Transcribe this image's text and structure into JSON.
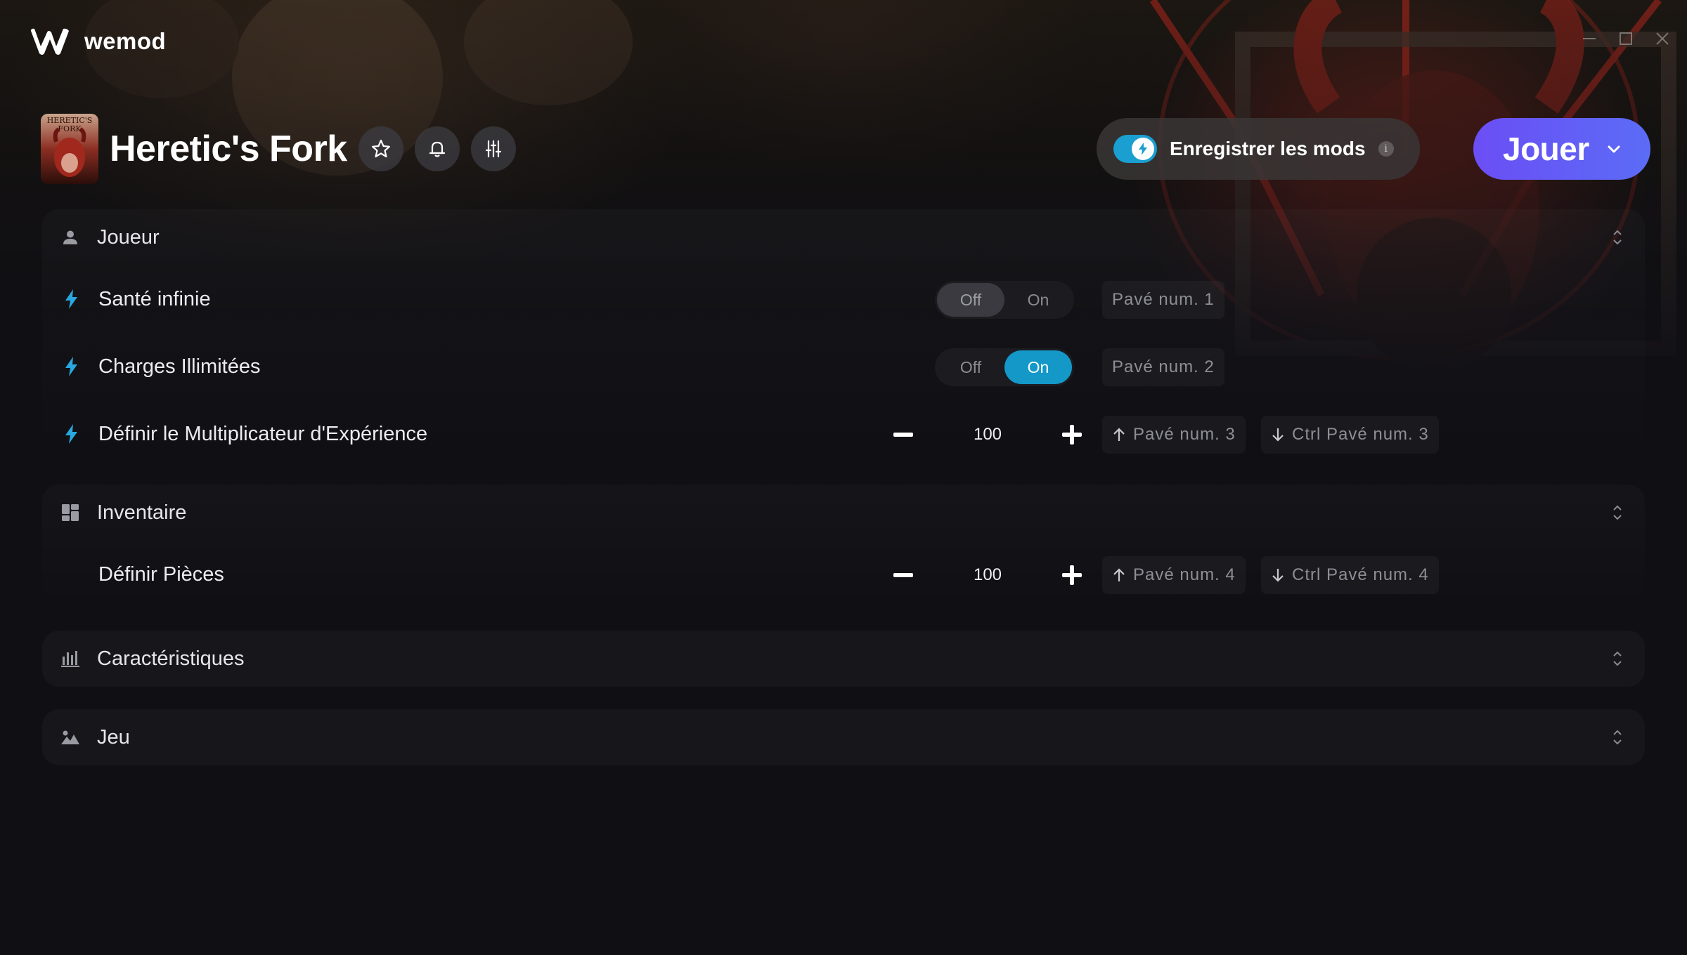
{
  "app": {
    "brand": "wemod"
  },
  "game": {
    "title": "Heretic's Fork",
    "thumb_title": "HERETIC'S FORK"
  },
  "header": {
    "favorite_icon": "star-icon",
    "notify_icon": "bell-icon",
    "settings_icon": "sliders-icon",
    "save_mods_label": "Enregistrer les mods",
    "save_mods_on": true,
    "info_glyph": "i",
    "play_label": "Jouer"
  },
  "colors": {
    "accent_toggle": "#1398c8",
    "play_gradient_start": "#6b4ef5",
    "play_gradient_end": "#5b6cf6",
    "mod_icon": "#29a8e0"
  },
  "sections": [
    {
      "title": "Joueur",
      "icon": "user-icon",
      "expanded": true,
      "mods": [
        {
          "label": "Santé infinie",
          "type": "toggle",
          "off_label": "Off",
          "on_label": "On",
          "state": "off",
          "hotkeys": [
            "Pavé num. 1"
          ]
        },
        {
          "label": "Charges Illimitées",
          "type": "toggle",
          "off_label": "Off",
          "on_label": "On",
          "state": "on",
          "hotkeys": [
            "Pavé num. 2"
          ]
        },
        {
          "label": "Définir le Multiplicateur d'Expérience",
          "type": "stepper",
          "value": "100",
          "hotkeys": [
            "Pavé num. 3",
            "Ctrl Pavé num. 3"
          ]
        }
      ]
    },
    {
      "title": "Inventaire",
      "icon": "grid-icon",
      "expanded": true,
      "mods": [
        {
          "label": "Définir Pièces",
          "type": "stepper",
          "value": "100",
          "hotkeys": [
            "Pavé num. 4",
            "Ctrl Pavé num. 4"
          ]
        }
      ]
    },
    {
      "title": "Caractéristiques",
      "icon": "bar-chart-icon",
      "expanded": false
    },
    {
      "title": "Jeu",
      "icon": "landscape-icon",
      "expanded": false
    }
  ]
}
